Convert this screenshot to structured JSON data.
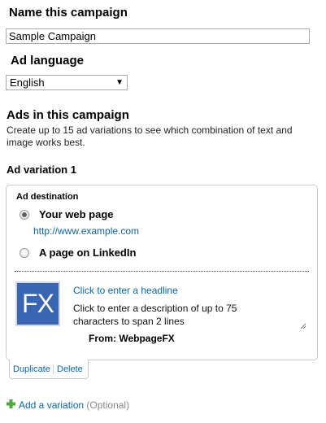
{
  "campaign_name": {
    "label": "Name this campaign",
    "value": "Sample Campaign"
  },
  "ad_language": {
    "label": "Ad language",
    "selected": "English"
  },
  "ads_section": {
    "title": "Ads in this campaign",
    "description": "Create up to 15 ad variations to see which combination of text and image works best."
  },
  "variation": {
    "title": "Ad variation 1",
    "destination_title": "Ad destination",
    "options": [
      {
        "label": "Your web page",
        "selected": true,
        "url": "http://www.example.com"
      },
      {
        "label": "A page on LinkedIn",
        "selected": false
      }
    ],
    "logo_text": "FX",
    "headline_placeholder": "Click to enter a headline",
    "description_placeholder": "Click to enter a description of up to 75 characters to span 2 lines",
    "from_label": "From: WebpageFX",
    "actions": {
      "duplicate": "Duplicate",
      "delete": "Delete"
    }
  },
  "add_variation": {
    "label": "Add a variation",
    "note": "(Optional)"
  },
  "colors": {
    "link": "#0a66a8",
    "logo_bg": "#3a65b0",
    "add_icon": "#4fa83a"
  }
}
